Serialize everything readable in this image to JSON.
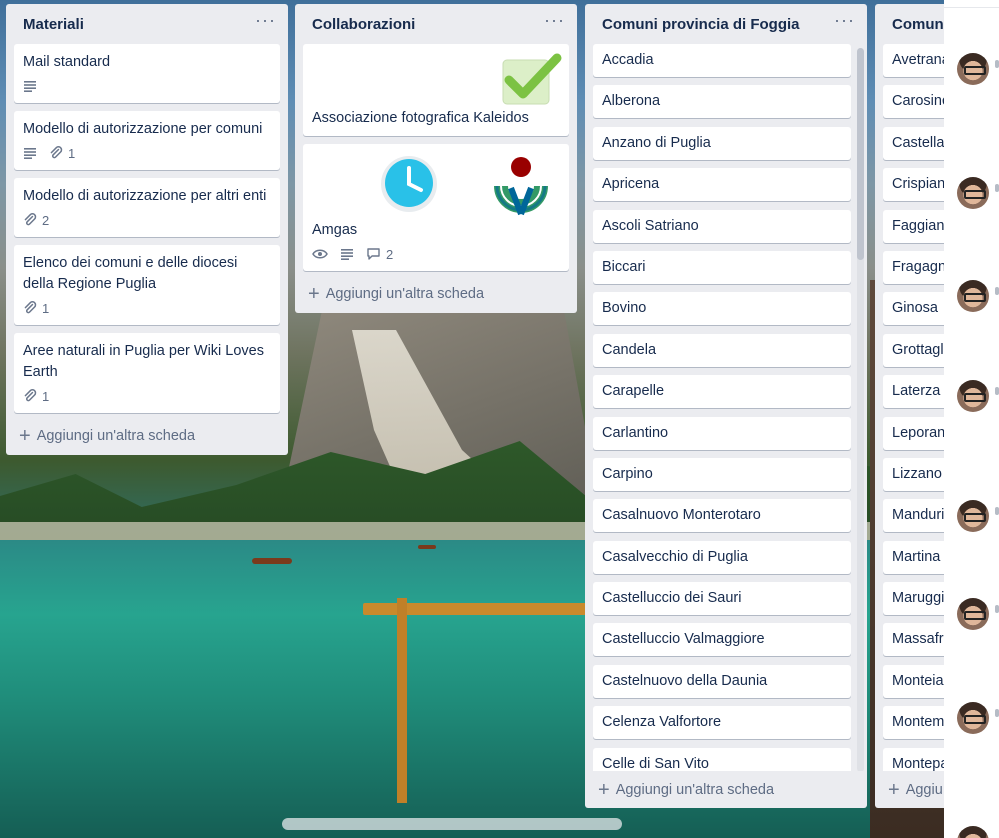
{
  "board": {
    "add_card_label": "Aggiungi un'altra scheda",
    "menu_glyph": "···"
  },
  "lists": [
    {
      "title": "Materiali",
      "cards": [
        {
          "title": "Mail standard",
          "description": true
        },
        {
          "title": "Modello di autorizzazione per comuni",
          "description": true,
          "attachments": "1"
        },
        {
          "title": "Modello di autorizzazione per altri enti",
          "attachments": "2"
        },
        {
          "title": "Elenco dei comuni e delle diocesi della Regione Puglia",
          "attachments": "1"
        },
        {
          "title": "Aree naturali in Puglia per Wiki Loves Earth",
          "attachments": "1"
        }
      ]
    },
    {
      "title": "Collaborazioni",
      "cards": [
        {
          "title": "Associazione fotografica Kaleidos",
          "cover_icon": "checkmark-icon"
        },
        {
          "title": "Amgas",
          "images": [
            "clock-icon",
            "wikimedia-logo-icon"
          ],
          "watching": true,
          "description": true,
          "comments": "2"
        }
      ]
    },
    {
      "title": "Comuni provincia di Foggia",
      "cards": [
        "Accadia",
        "Alberona",
        "Anzano di Puglia",
        "Apricena",
        "Ascoli Satriano",
        "Biccari",
        "Bovino",
        "Candela",
        "Carapelle",
        "Carlantino",
        "Carpino",
        "Casalnuovo Monterotaro",
        "Casalvecchio di Puglia",
        "Castelluccio dei Sauri",
        "Castelluccio Valmaggiore",
        "Castelnuovo della Daunia",
        "Celenza Valfortore",
        "Celle di San Vito"
      ]
    },
    {
      "title": "Comuni",
      "cards": [
        "Avetrana",
        "Carosino",
        "Castella",
        "Crispian",
        "Faggian",
        "Fragagn",
        "Ginosa",
        "Grottagl",
        "Laterza",
        "Leporan",
        "Lizzano",
        "Manduri",
        "Martina",
        "Maruggi",
        "Massafr",
        "Monteia",
        "Montem",
        "Montepa"
      ],
      "add_card_label": "Aggiu"
    }
  ],
  "side_panel": {
    "avatars": 8
  },
  "colors": {
    "list_bg": "#ebecf0",
    "card_bg": "#ffffff",
    "text": "#172b4d",
    "muted": "#5e6c84"
  }
}
